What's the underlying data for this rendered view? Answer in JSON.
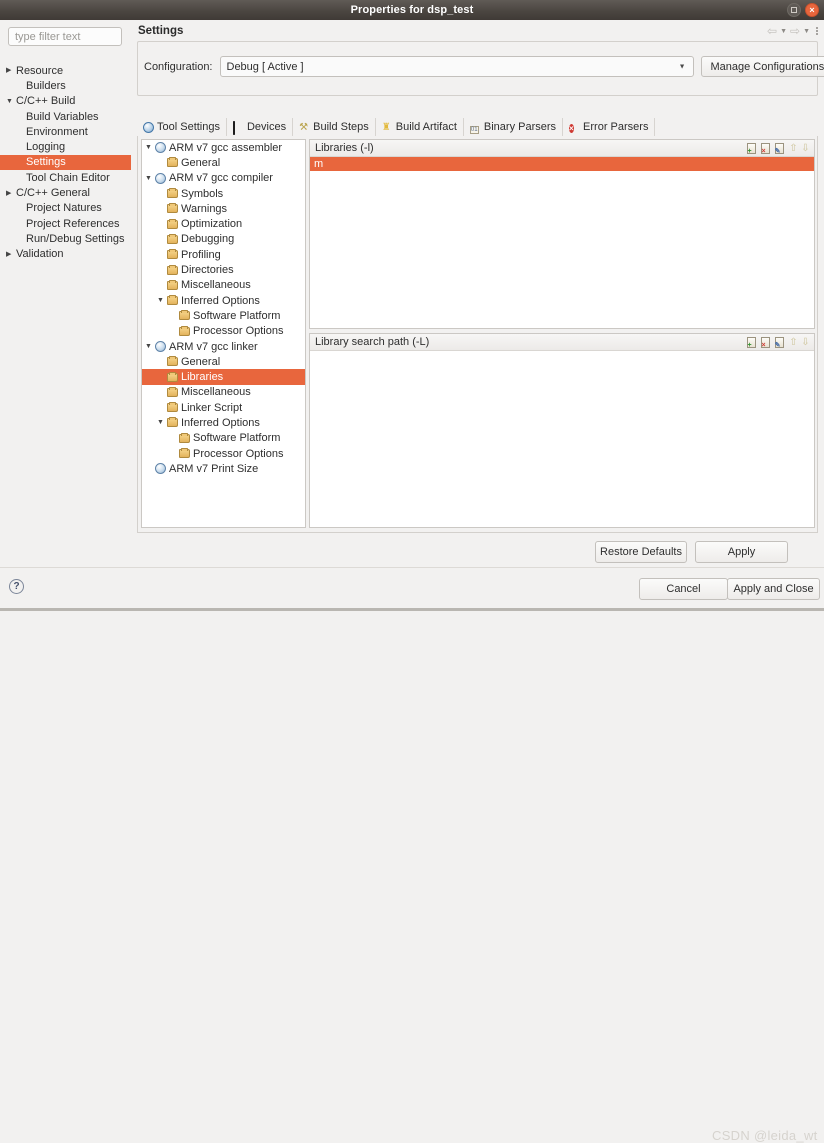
{
  "window": {
    "title": "Properties for dsp_test",
    "controls": [
      {
        "name": "maximize",
        "glyph": ""
      },
      {
        "name": "close",
        "glyph": "×"
      }
    ]
  },
  "filter": {
    "placeholder": "type filter text",
    "value": ""
  },
  "sidebar": {
    "items": [
      {
        "label": "Resource",
        "indent": 0,
        "arrow": "▶",
        "selected": false
      },
      {
        "label": "Builders",
        "indent": 1,
        "arrow": "",
        "selected": false
      },
      {
        "label": "C/C++ Build",
        "indent": 0,
        "arrow": "▼",
        "selected": false
      },
      {
        "label": "Build Variables",
        "indent": 1,
        "arrow": "",
        "selected": false
      },
      {
        "label": "Environment",
        "indent": 1,
        "arrow": "",
        "selected": false
      },
      {
        "label": "Logging",
        "indent": 1,
        "arrow": "",
        "selected": false
      },
      {
        "label": "Settings",
        "indent": 1,
        "arrow": "",
        "selected": true
      },
      {
        "label": "Tool Chain Editor",
        "indent": 1,
        "arrow": "",
        "selected": false
      },
      {
        "label": "C/C++ General",
        "indent": 0,
        "arrow": "▶",
        "selected": false
      },
      {
        "label": "Project Natures",
        "indent": 1,
        "arrow": "",
        "selected": false
      },
      {
        "label": "Project References",
        "indent": 1,
        "arrow": "",
        "selected": false
      },
      {
        "label": "Run/Debug Settings",
        "indent": 1,
        "arrow": "",
        "selected": false
      },
      {
        "label": "Validation",
        "indent": 0,
        "arrow": "▶",
        "selected": false
      }
    ]
  },
  "page": {
    "title": "Settings",
    "nav": {
      "back": "⇦",
      "back_menu": "▼",
      "forward": "⇨",
      "forward_menu": "▼",
      "view_menu": "view-menu"
    }
  },
  "configuration": {
    "label": "Configuration:",
    "value": "Debug  [ Active ]",
    "caret": "▼",
    "manage_label": "Manage Configurations..."
  },
  "tabs": [
    {
      "label": "Tool Settings",
      "icon": "globe-icon",
      "active": true
    },
    {
      "label": "Devices",
      "icon": "device-icon",
      "active": false
    },
    {
      "label": "Build Steps",
      "icon": "wrench-icon",
      "active": false
    },
    {
      "label": "Build Artifact",
      "icon": "trophy-icon",
      "active": false
    },
    {
      "label": "Binary Parsers",
      "icon": "binary-icon",
      "active": false
    },
    {
      "label": "Error Parsers",
      "icon": "error-icon",
      "active": false
    }
  ],
  "tool_tree": [
    {
      "label": "ARM v7 gcc assembler",
      "depth": 0,
      "arrow": "▼",
      "icon": "tool",
      "selected": false
    },
    {
      "label": "General",
      "depth": 1,
      "arrow": "",
      "icon": "folder",
      "selected": false
    },
    {
      "label": "ARM v7 gcc compiler",
      "depth": 0,
      "arrow": "▼",
      "icon": "tool",
      "selected": false
    },
    {
      "label": "Symbols",
      "depth": 1,
      "arrow": "",
      "icon": "folder",
      "selected": false
    },
    {
      "label": "Warnings",
      "depth": 1,
      "arrow": "",
      "icon": "folder",
      "selected": false
    },
    {
      "label": "Optimization",
      "depth": 1,
      "arrow": "",
      "icon": "folder",
      "selected": false
    },
    {
      "label": "Debugging",
      "depth": 1,
      "arrow": "",
      "icon": "folder",
      "selected": false
    },
    {
      "label": "Profiling",
      "depth": 1,
      "arrow": "",
      "icon": "folder",
      "selected": false
    },
    {
      "label": "Directories",
      "depth": 1,
      "arrow": "",
      "icon": "folder",
      "selected": false
    },
    {
      "label": "Miscellaneous",
      "depth": 1,
      "arrow": "",
      "icon": "folder",
      "selected": false
    },
    {
      "label": "Inferred Options",
      "depth": 1,
      "arrow": "▼",
      "icon": "folder",
      "selected": false
    },
    {
      "label": "Software Platform",
      "depth": 2,
      "arrow": "",
      "icon": "folder",
      "selected": false
    },
    {
      "label": "Processor Options",
      "depth": 2,
      "arrow": "",
      "icon": "folder",
      "selected": false
    },
    {
      "label": "ARM v7 gcc linker",
      "depth": 0,
      "arrow": "▼",
      "icon": "tool",
      "selected": false
    },
    {
      "label": "General",
      "depth": 1,
      "arrow": "",
      "icon": "folder",
      "selected": false
    },
    {
      "label": "Libraries",
      "depth": 1,
      "arrow": "",
      "icon": "folder",
      "selected": true
    },
    {
      "label": "Miscellaneous",
      "depth": 1,
      "arrow": "",
      "icon": "folder",
      "selected": false
    },
    {
      "label": "Linker Script",
      "depth": 1,
      "arrow": "",
      "icon": "folder",
      "selected": false
    },
    {
      "label": "Inferred Options",
      "depth": 1,
      "arrow": "▼",
      "icon": "folder",
      "selected": false
    },
    {
      "label": "Software Platform",
      "depth": 2,
      "arrow": "",
      "icon": "folder",
      "selected": false
    },
    {
      "label": "Processor Options",
      "depth": 2,
      "arrow": "",
      "icon": "folder",
      "selected": false
    },
    {
      "label": "ARM v7 Print Size",
      "depth": 0,
      "arrow": "",
      "icon": "tool",
      "selected": false
    }
  ],
  "lists": [
    {
      "id": "libraries",
      "title": "Libraries (-l)",
      "items": [
        {
          "value": "m",
          "selected": true
        }
      ],
      "tools": [
        {
          "name": "add-icon",
          "glyph": "+",
          "kind": "doc",
          "badge": "add"
        },
        {
          "name": "delete-icon",
          "glyph": "×",
          "kind": "doc",
          "badge": "del"
        },
        {
          "name": "edit-icon",
          "glyph": "✎",
          "kind": "doc",
          "badge": "edit"
        },
        {
          "name": "move-up-icon",
          "glyph": "⇧",
          "kind": "arrow",
          "badge": ""
        },
        {
          "name": "move-down-icon",
          "glyph": "⇩",
          "kind": "arrow",
          "badge": ""
        }
      ]
    },
    {
      "id": "library-search-path",
      "title": "Library search path (-L)",
      "items": [],
      "tools": [
        {
          "name": "add-icon",
          "glyph": "+",
          "kind": "doc",
          "badge": "add"
        },
        {
          "name": "delete-icon",
          "glyph": "×",
          "kind": "doc",
          "badge": "del"
        },
        {
          "name": "edit-icon",
          "glyph": "✎",
          "kind": "doc",
          "badge": "edit"
        },
        {
          "name": "move-up-icon",
          "glyph": "⇧",
          "kind": "arrow",
          "badge": ""
        },
        {
          "name": "move-down-icon",
          "glyph": "⇩",
          "kind": "arrow",
          "badge": ""
        }
      ]
    }
  ],
  "buttons": {
    "restore_defaults": "Restore Defaults",
    "apply": "Apply",
    "cancel": "Cancel",
    "apply_and_close": "Apply and Close",
    "help": "?"
  },
  "watermark": "CSDN @leida_wt",
  "colors": {
    "selection": "#e8663d",
    "titlebar": "#4b4641",
    "close_button": "#e8663d",
    "panel_bg": "#f2f1f0",
    "list_bg": "#ffffff"
  }
}
